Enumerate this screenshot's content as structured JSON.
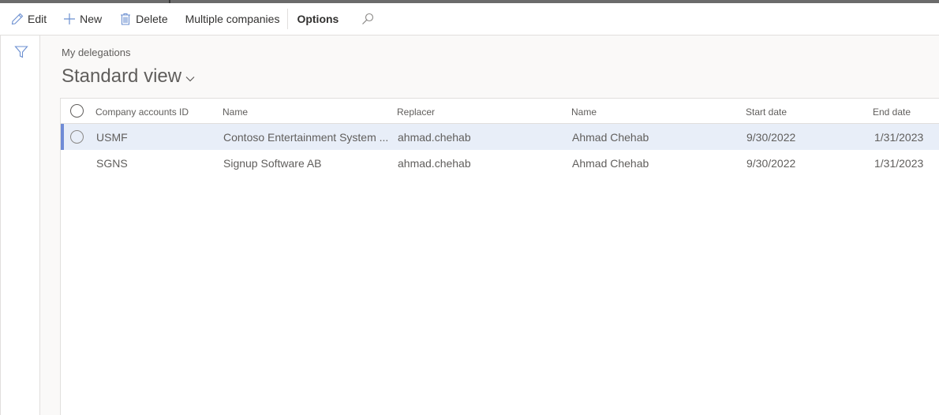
{
  "toolbar": {
    "edit_label": "Edit",
    "new_label": "New",
    "delete_label": "Delete",
    "multiple_companies_label": "Multiple companies",
    "options_label": "Options"
  },
  "page": {
    "breadcrumb": "My delegations",
    "view_title": "Standard view"
  },
  "grid": {
    "columns": [
      "Company accounts ID",
      "Name",
      "Replacer",
      "Name",
      "Start date",
      "End date"
    ],
    "rows": [
      {
        "company": "USMF",
        "name": "Contoso Entertainment System ...",
        "replacer": "ahmad.chehab",
        "replacer_name": "Ahmad Chehab",
        "start": "9/30/2022",
        "end": "1/31/2023",
        "selected": true
      },
      {
        "company": "SGNS",
        "name": "Signup Software AB",
        "replacer": "ahmad.chehab",
        "replacer_name": "Ahmad Chehab",
        "start": "9/30/2022",
        "end": "1/31/2023",
        "selected": false
      }
    ]
  },
  "colors": {
    "accent": "#6f8bd6",
    "selected_row": "#e8eef8",
    "icon": "#6b8fd0"
  },
  "icons": [
    "pencil-icon",
    "plus-icon",
    "trash-icon",
    "search-icon",
    "filter-icon",
    "chevron-down-icon"
  ]
}
